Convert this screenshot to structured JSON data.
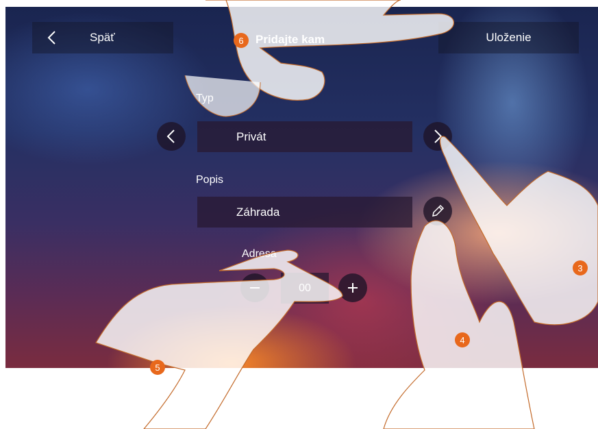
{
  "header": {
    "back_label": "Späť",
    "title": "Pridajte kam",
    "save_label": "Uloženie"
  },
  "form": {
    "type_label": "Typ",
    "type_value": "Privát",
    "description_label": "Popis",
    "description_value": "Záhrada",
    "address_label": "Adresa",
    "address_value": "00"
  },
  "callouts": [
    "6",
    "3",
    "4",
    "5"
  ],
  "colors": {
    "callout": "#e8681c",
    "button_bg": "#1e1428"
  },
  "icons": {
    "back": "chevron-left-icon",
    "type_prev": "chevron-left-icon",
    "type_next": "chevron-right-icon",
    "edit": "pencil-icon",
    "increment": "plus-icon",
    "decrement": "minus-icon"
  }
}
